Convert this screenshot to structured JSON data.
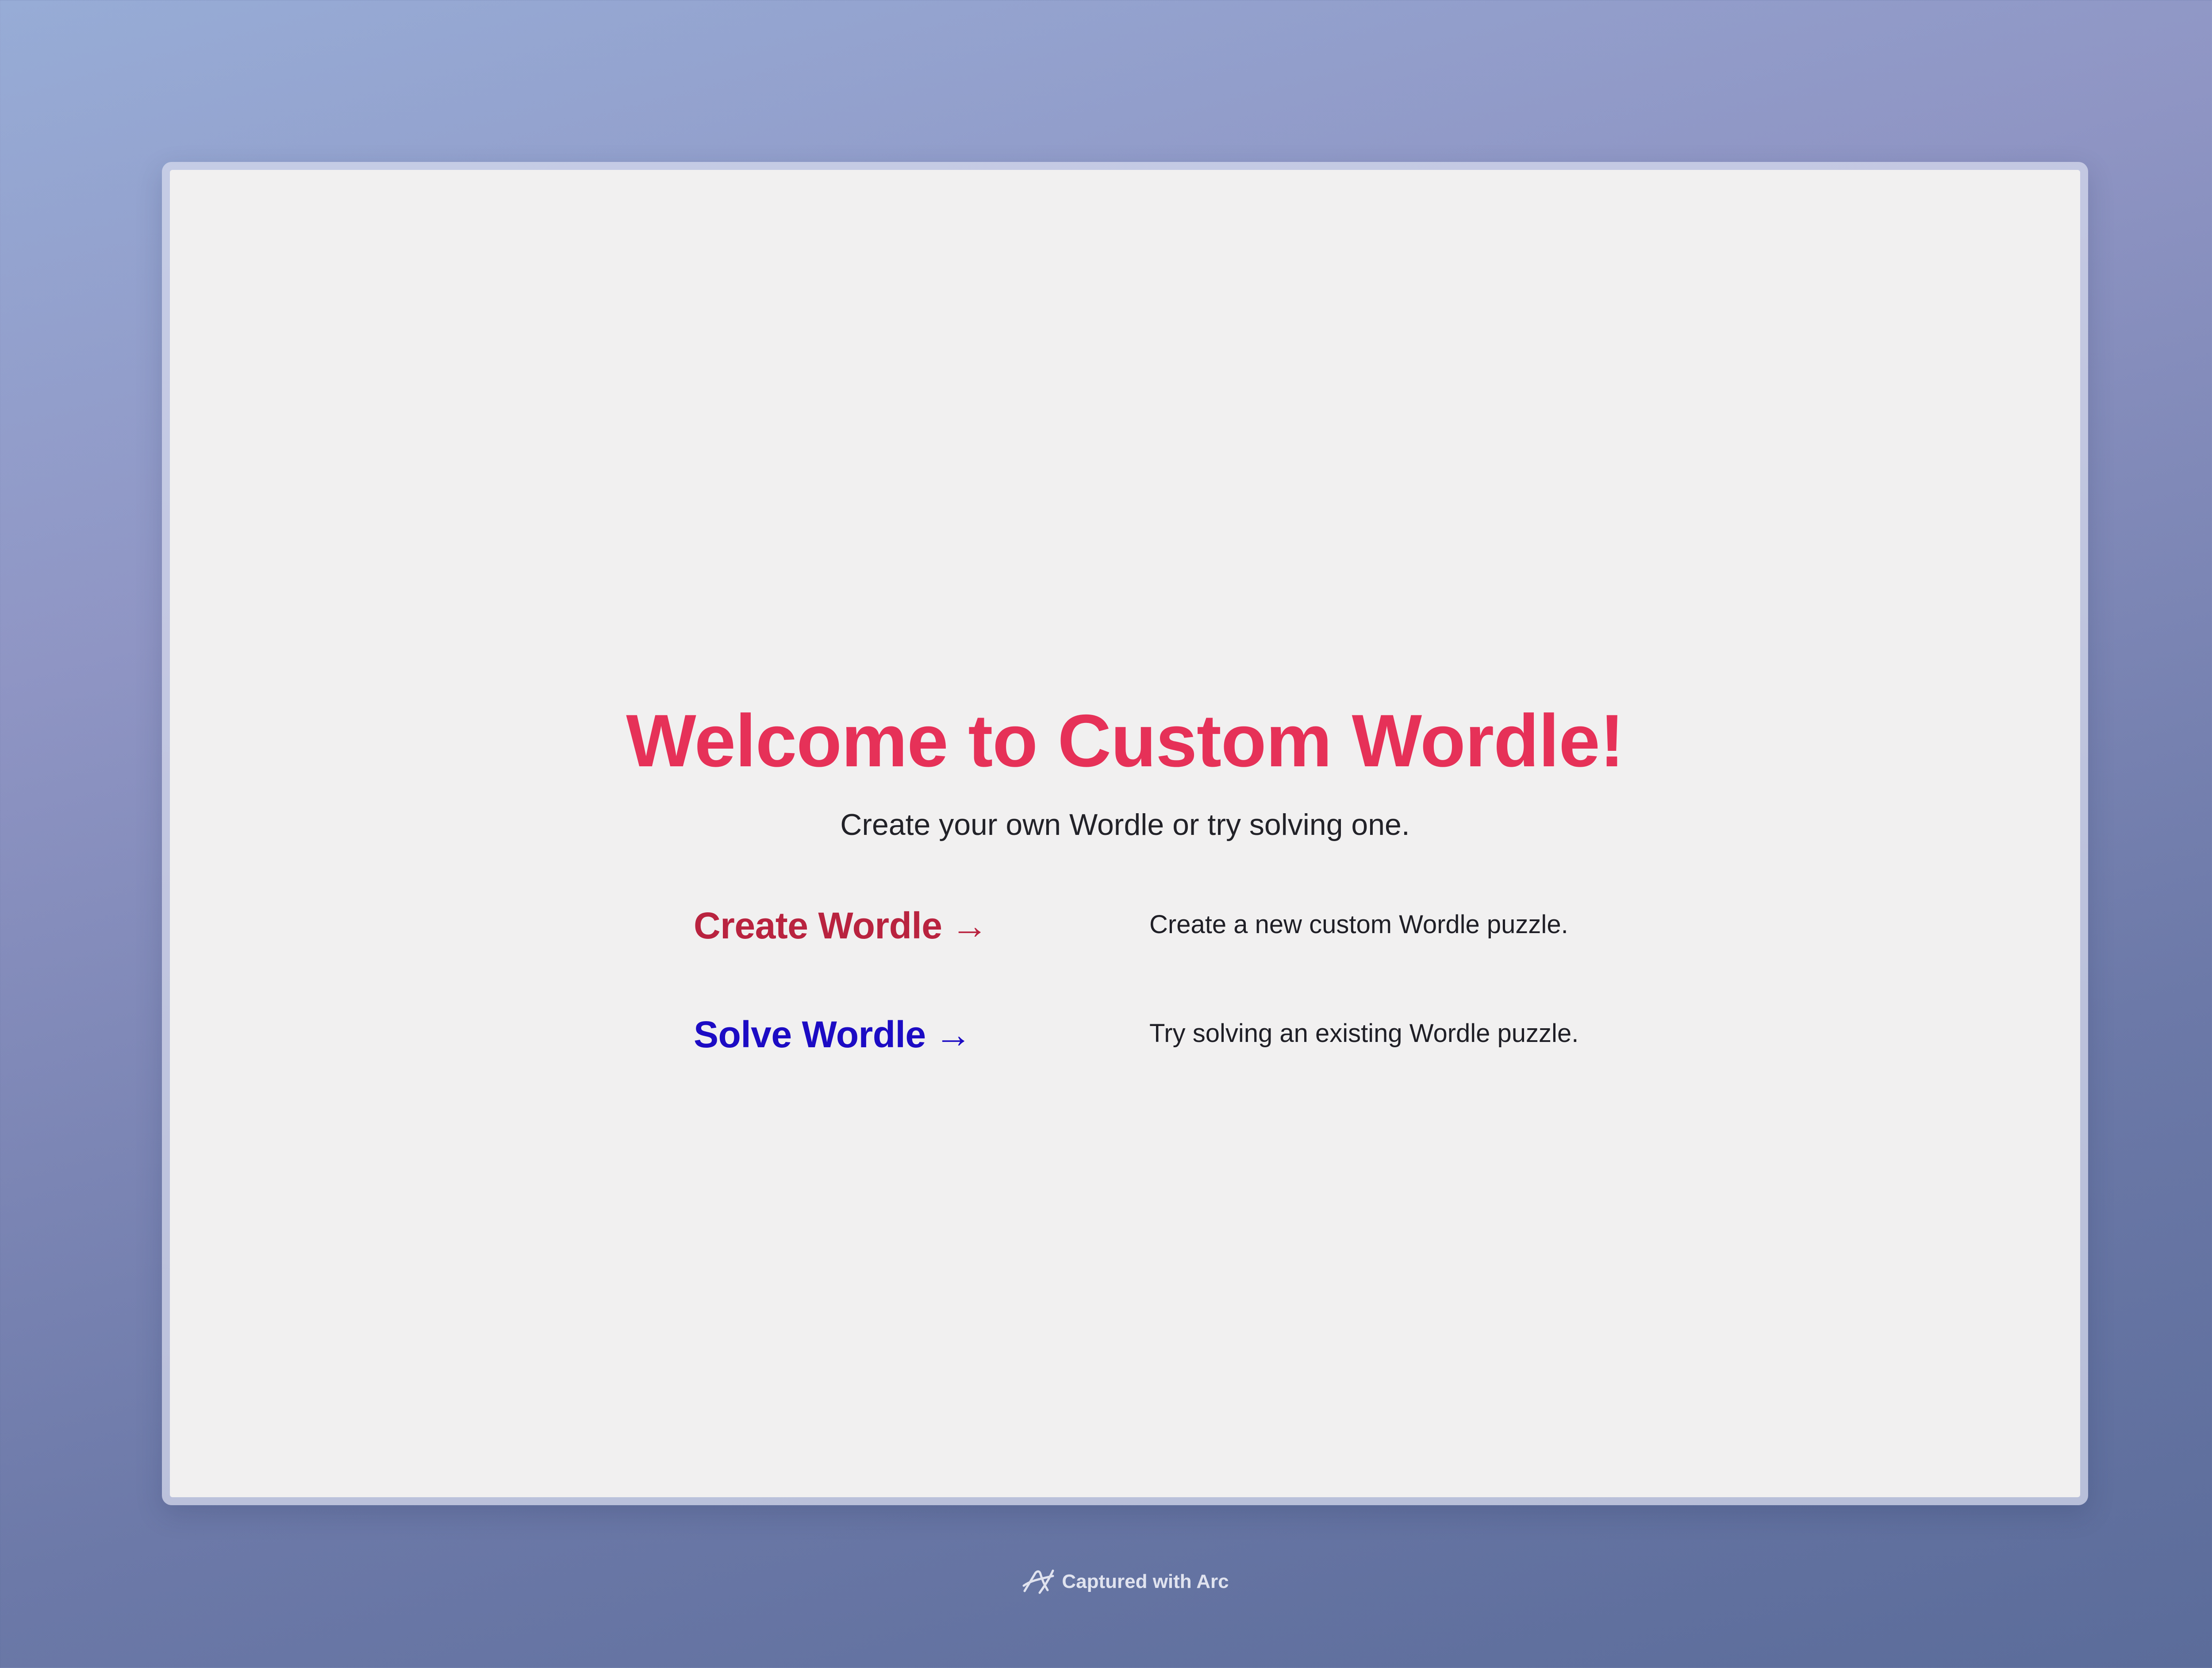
{
  "page": {
    "title": "Welcome to Custom Wordle!",
    "subtitle": "Create your own Wordle or try solving one."
  },
  "options": [
    {
      "label": "Create Wordle",
      "arrow": "→",
      "description": "Create a new custom Wordle puzzle.",
      "color": "#b9233f"
    },
    {
      "label": "Solve Wordle",
      "arrow": "→",
      "description": "Try solving an existing Wordle puzzle.",
      "color": "#1c0bc4"
    }
  ],
  "footer": {
    "icon": "arc-logo-icon",
    "text": "Captured with Arc"
  },
  "colors": {
    "title": "#e63158",
    "page_background": "#f1f0f0"
  }
}
